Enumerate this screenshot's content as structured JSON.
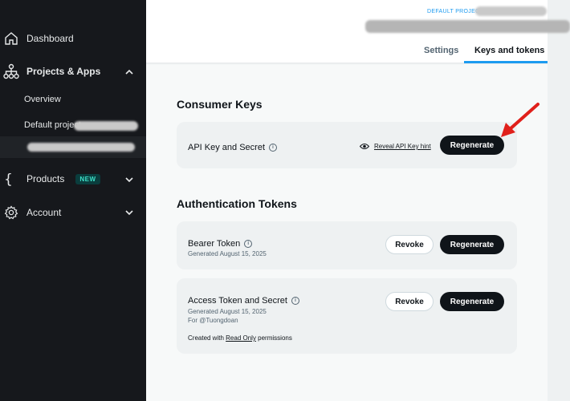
{
  "sidebar": {
    "dashboard": {
      "label": "Dashboard",
      "icon": "home-icon"
    },
    "projects": {
      "label": "Projects & Apps",
      "icon": "hierarchy-icon"
    },
    "sub_items": {
      "overview": "Overview",
      "default_project": "Default project"
    },
    "products": {
      "label": "Products",
      "badge": "NEW",
      "icon": "braces-icon"
    },
    "account": {
      "label": "Account",
      "icon": "gear-icon"
    }
  },
  "header": {
    "project_label": "DEFAULT PROJECT",
    "tabs": [
      {
        "label": "Settings",
        "active": false
      },
      {
        "label": "Keys and tokens",
        "active": true
      }
    ]
  },
  "consumer_keys": {
    "title": "Consumer Keys",
    "api_key": {
      "label": "API Key and Secret",
      "reveal_label": "Reveal API Key hint",
      "regenerate_label": "Regenerate"
    }
  },
  "auth_tokens": {
    "title": "Authentication Tokens",
    "bearer": {
      "label": "Bearer Token",
      "generated": "Generated August 15, 2025",
      "revoke_label": "Revoke",
      "regenerate_label": "Regenerate"
    },
    "access": {
      "label": "Access Token and Secret",
      "generated": "Generated August 15, 2025",
      "for": "For @Tuongdoan",
      "note_prefix": "Created with ",
      "note_link": "Read Only",
      "note_suffix": " permissions",
      "revoke_label": "Revoke",
      "regenerate_label": "Regenerate"
    }
  },
  "colors": {
    "sidebar_bg": "#16181c",
    "accent": "#1d9bf0",
    "button_dark": "#0f1419",
    "arrow": "#e0201b"
  }
}
